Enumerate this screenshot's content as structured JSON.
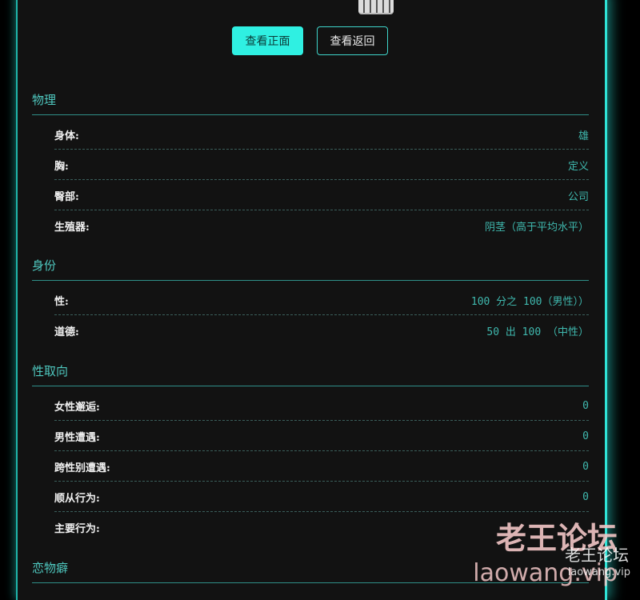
{
  "buttons": {
    "view_front": "查看正面",
    "view_back": "查看返回"
  },
  "sections": [
    {
      "title": "物理",
      "rows": [
        {
          "label": "身体:",
          "value": "雄"
        },
        {
          "label": "胸:",
          "value": "定义"
        },
        {
          "label": "臀部:",
          "value": "公司"
        },
        {
          "label": "生殖器:",
          "value": "阴茎（高于平均水平）"
        }
      ]
    },
    {
      "title": "身份",
      "rows": [
        {
          "label": "性:",
          "value": "100 分之 100（男性））"
        },
        {
          "label": "道德:",
          "value": "50 出 100 （中性）"
        }
      ]
    },
    {
      "title": "性取向",
      "rows": [
        {
          "label": "女性邂逅:",
          "value": "0"
        },
        {
          "label": "男性遭遇:",
          "value": "0"
        },
        {
          "label": "跨性别遭遇:",
          "value": "0"
        },
        {
          "label": "顺从行为:",
          "value": "0"
        },
        {
          "label": "主要行为:",
          "value": ""
        }
      ]
    },
    {
      "title": "恋物癖",
      "rows": []
    }
  ],
  "watermark": {
    "brand": "老王论坛",
    "url": "laowang.vip",
    "brand_small": "老王论坛",
    "url_small": "laowang.vip"
  },
  "colors": {
    "accent": "#2ff0e2",
    "value_text": "#3fb8ae",
    "section_title": "#4fc9c0",
    "panel_bg": "#121212"
  }
}
